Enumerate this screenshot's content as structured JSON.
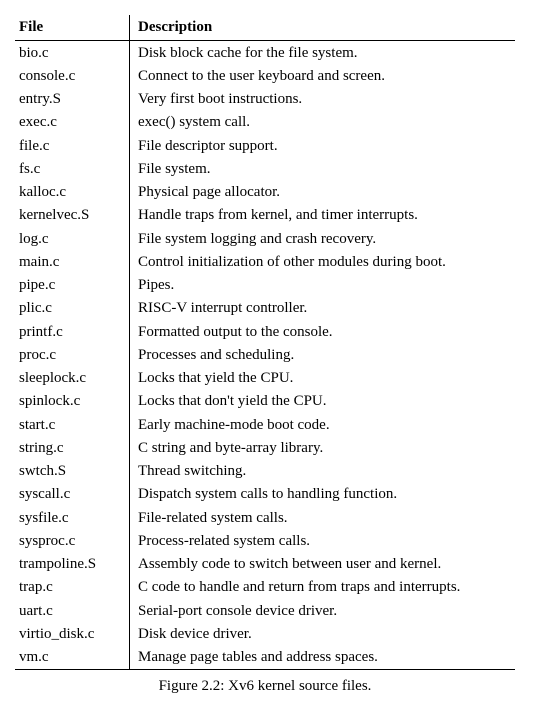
{
  "headers": {
    "file": "File",
    "description": "Description"
  },
  "rows": [
    {
      "file": "bio.c",
      "description": "Disk block cache for the file system."
    },
    {
      "file": "console.c",
      "description": "Connect to the user keyboard and screen."
    },
    {
      "file": "entry.S",
      "description": "Very first boot instructions."
    },
    {
      "file": "exec.c",
      "description": "exec() system call."
    },
    {
      "file": "file.c",
      "description": "File descriptor support."
    },
    {
      "file": "fs.c",
      "description": "File system."
    },
    {
      "file": "kalloc.c",
      "description": "Physical page allocator."
    },
    {
      "file": "kernelvec.S",
      "description": "Handle traps from kernel, and timer interrupts."
    },
    {
      "file": "log.c",
      "description": "File system logging and crash recovery."
    },
    {
      "file": "main.c",
      "description": "Control initialization of other modules during boot."
    },
    {
      "file": "pipe.c",
      "description": "Pipes."
    },
    {
      "file": "plic.c",
      "description": "RISC-V interrupt controller."
    },
    {
      "file": "printf.c",
      "description": "Formatted output to the console."
    },
    {
      "file": "proc.c",
      "description": "Processes and scheduling."
    },
    {
      "file": "sleeplock.c",
      "description": "Locks that yield the CPU."
    },
    {
      "file": "spinlock.c",
      "description": "Locks that don't yield the CPU."
    },
    {
      "file": "start.c",
      "description": "Early machine-mode boot code."
    },
    {
      "file": "string.c",
      "description": "C string and byte-array library."
    },
    {
      "file": "swtch.S",
      "description": "Thread switching."
    },
    {
      "file": "syscall.c",
      "description": "Dispatch system calls to handling function."
    },
    {
      "file": "sysfile.c",
      "description": "File-related system calls."
    },
    {
      "file": "sysproc.c",
      "description": "Process-related system calls."
    },
    {
      "file": "trampoline.S",
      "description": "Assembly code to switch between user and kernel."
    },
    {
      "file": "trap.c",
      "description": "C code to handle and return from traps and interrupts."
    },
    {
      "file": "uart.c",
      "description": "Serial-port console device driver."
    },
    {
      "file": "virtio_disk.c",
      "description": "Disk device driver."
    },
    {
      "file": "vm.c",
      "description": "Manage page tables and address spaces."
    }
  ],
  "caption": "Figure 2.2: Xv6 kernel source files."
}
